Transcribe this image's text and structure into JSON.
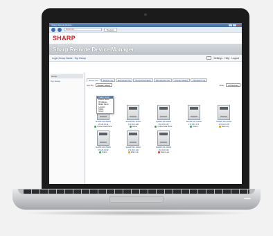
{
  "browser": {
    "window_title": "Sharp Remote Device...",
    "address": "http://srdm",
    "tab_label": "Devices"
  },
  "app": {
    "brand": "SHARP",
    "title": "Sharp Remote Device Manager",
    "login_text": "Login Group Name : Top Group",
    "links": [
      "Settings",
      "Help",
      "Logout"
    ]
  },
  "sidebar": {
    "header": "Group",
    "tree_item": "Top Group"
  },
  "tabs": [
    "Device List",
    "Device Log",
    "Sub Group List",
    "Group Information",
    "New Device List",
    "Counter History",
    "Operation Log"
  ],
  "sort": {
    "label": "Sort By:",
    "value": "Please Select",
    "filter_label": "Filter:",
    "filter_value": "All Devices"
  },
  "sort_menu": [
    "Please Select",
    "Device Name",
    "IP Address",
    "Model Name",
    "Location",
    "Status",
    "Group"
  ],
  "devices": [
    {
      "name": "SHARP MX-2600N",
      "ip": "172.29.0.114",
      "status": "Online Data Plane"
    },
    {
      "name": "SHARP MX-4101N",
      "ip": "172.29.0.128",
      "status": "Online"
    },
    {
      "name": "SHARP MX-6000N",
      "ip": "172.29.0.136",
      "status": "Online Data Plane"
    },
    {
      "name": "SHARP MX-4100N",
      "ip": "172.29.0.173",
      "status": "Online"
    },
    {
      "name": "SHARP MX-4101N",
      "ip": "172.29.0.178",
      "status": "Warm-Up"
    },
    {
      "name": "SHARP MX-3500N",
      "ip": "172.29.0.199",
      "status": "Online"
    },
    {
      "name": "SHARP MX-2301N",
      "ip": "172.29.0.134",
      "status": "Warm-Up"
    },
    {
      "name": "SHARP MX-3100N",
      "ip": "172.29.0.139",
      "status": "Paper Low"
    }
  ],
  "colors": {
    "brand": "#d61f26",
    "online": "#3aa655",
    "warning": "#e0a020",
    "error": "#d33a2c"
  }
}
